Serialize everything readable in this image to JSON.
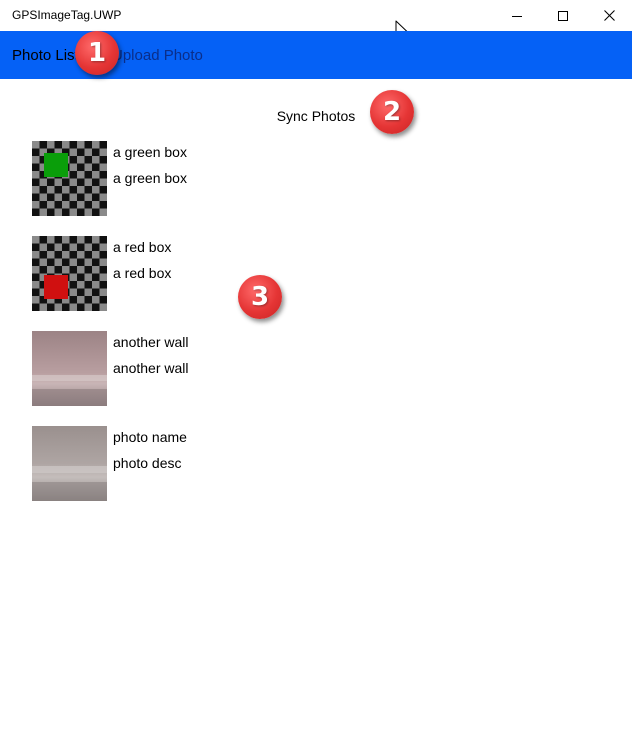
{
  "window": {
    "title": "GPSImageTag.UWP"
  },
  "nav": {
    "photo_list_label": "Photo List",
    "upload_label": "Upload Photo",
    "background_color": "#0561f6"
  },
  "toolbar": {
    "sync_label": "Sync Photos"
  },
  "callouts": [
    "1",
    "2",
    "3"
  ],
  "photos": [
    {
      "name": "a green box",
      "description": "a green box",
      "thumbnail": "checkerboard-green-square"
    },
    {
      "name": "a red box",
      "description": "a red box",
      "thumbnail": "checkerboard-red-square"
    },
    {
      "name": "another wall",
      "description": "another wall",
      "thumbnail": "photo-pink-wall"
    },
    {
      "name": "photo name",
      "description": "photo desc",
      "thumbnail": "photo-grey-wall"
    }
  ],
  "colors": {
    "green_box": "#0a9e0a",
    "red_box": "#d01010",
    "callout": "#e53535"
  }
}
